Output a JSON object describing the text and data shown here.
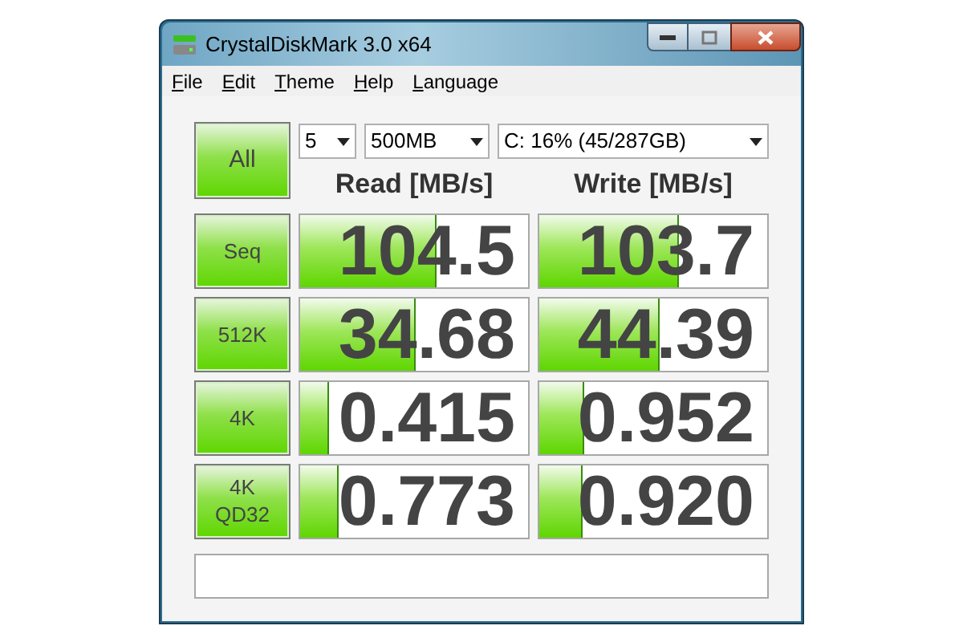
{
  "window": {
    "title": "CrystalDiskMark 3.0 x64"
  },
  "menu": [
    "File",
    "Edit",
    "Theme",
    "Help",
    "Language"
  ],
  "all_button": "All",
  "selectors": [
    {
      "value": "5"
    },
    {
      "value": "500MB"
    },
    {
      "value": "C: 16% (45/287GB)"
    }
  ],
  "columns": [
    "Read [MB/s]",
    "Write [MB/s]"
  ],
  "rows": [
    {
      "label": [
        "Seq"
      ],
      "read": {
        "value": "104.5",
        "level": 0.6
      },
      "write": {
        "value": "103.7",
        "level": 0.61
      }
    },
    {
      "label": [
        "512K"
      ],
      "read": {
        "value": "34.68",
        "level": 0.51
      },
      "write": {
        "value": "44.39",
        "level": 0.53
      }
    },
    {
      "label": [
        "4K"
      ],
      "read": {
        "value": "0.415",
        "level": 0.13
      },
      "write": {
        "value": "0.952",
        "level": 0.2
      }
    },
    {
      "label": [
        "4K",
        "QD32"
      ],
      "read": {
        "value": "0.773",
        "level": 0.17
      },
      "write": {
        "value": "0.920",
        "level": 0.19
      }
    }
  ]
}
